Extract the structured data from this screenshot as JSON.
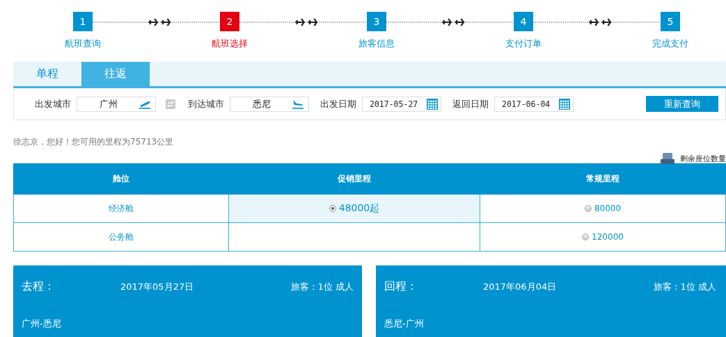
{
  "steps": [
    {
      "number": "1",
      "label": "航班查询",
      "current": false
    },
    {
      "number": "2",
      "label": "航班选择",
      "current": true
    },
    {
      "number": "3",
      "label": "旅客信息",
      "current": false
    },
    {
      "number": "4",
      "label": "支付订单",
      "current": false
    },
    {
      "number": "5",
      "label": "完成支付",
      "current": false
    }
  ],
  "tabs": [
    {
      "label": "单程",
      "selected": false
    },
    {
      "label": "往返",
      "selected": true
    }
  ],
  "search": {
    "fields": [
      {
        "kind": "from",
        "label": "出发城市",
        "value": "广州"
      },
      {
        "kind": "swap"
      },
      {
        "kind": "to",
        "label": "到达城市",
        "value": "悉尼"
      },
      {
        "kind": "date",
        "label": "出发日期",
        "value": "2017-05-27"
      },
      {
        "kind": "date",
        "label": "返回日期",
        "value": "2017-06-04"
      }
    ],
    "button": "重新查询"
  },
  "greeting": "徐志京，您好！您可用的里程为75713公里",
  "seats_legend": "剩余座位数量",
  "table": {
    "columns": [
      "舱位",
      "促销里程",
      "常规里程"
    ],
    "rows": [
      {
        "cabin": "经济舱",
        "promo": {
          "text": "48000起",
          "selected": true
        },
        "regular": {
          "text": "80000",
          "selected": false
        }
      },
      {
        "cabin": "公务舱",
        "regular": {
          "text": "120000",
          "selected": false
        }
      }
    ]
  },
  "trips": [
    {
      "label": "去程：",
      "date": "2017年05月27日",
      "passengers": "旅客：1位 成人",
      "route": "广州-悉尼"
    },
    {
      "label": "回程：",
      "date": "2017年06月04日",
      "passengers": "旅客：1位 成人",
      "route": "悉尼-广州"
    }
  ]
}
